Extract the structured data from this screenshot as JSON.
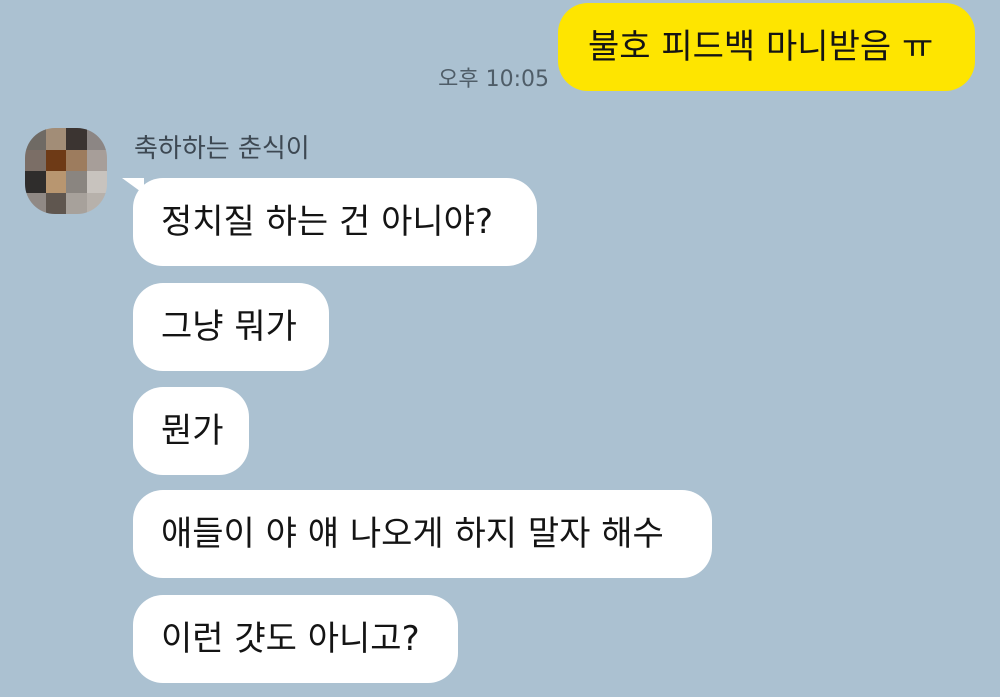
{
  "chat": {
    "outgoing": {
      "text": "불호 피드백 마니받음 ㅠ",
      "time": "오후 10:05"
    },
    "incoming": {
      "sender": "축하하는 춘식이",
      "messages": [
        "정치질 하는 건 아니야?",
        "그냥 뭐가",
        "뭔가",
        "애들이 야 얘 나오게 하지 말자 해수",
        "이런 걋도 아니고?"
      ]
    }
  },
  "colors": {
    "background": "#abc1d1",
    "outgoing_bubble": "#fee500",
    "incoming_bubble": "#ffffff"
  },
  "icons": {
    "avatar": "pixelated-profile-avatar"
  }
}
